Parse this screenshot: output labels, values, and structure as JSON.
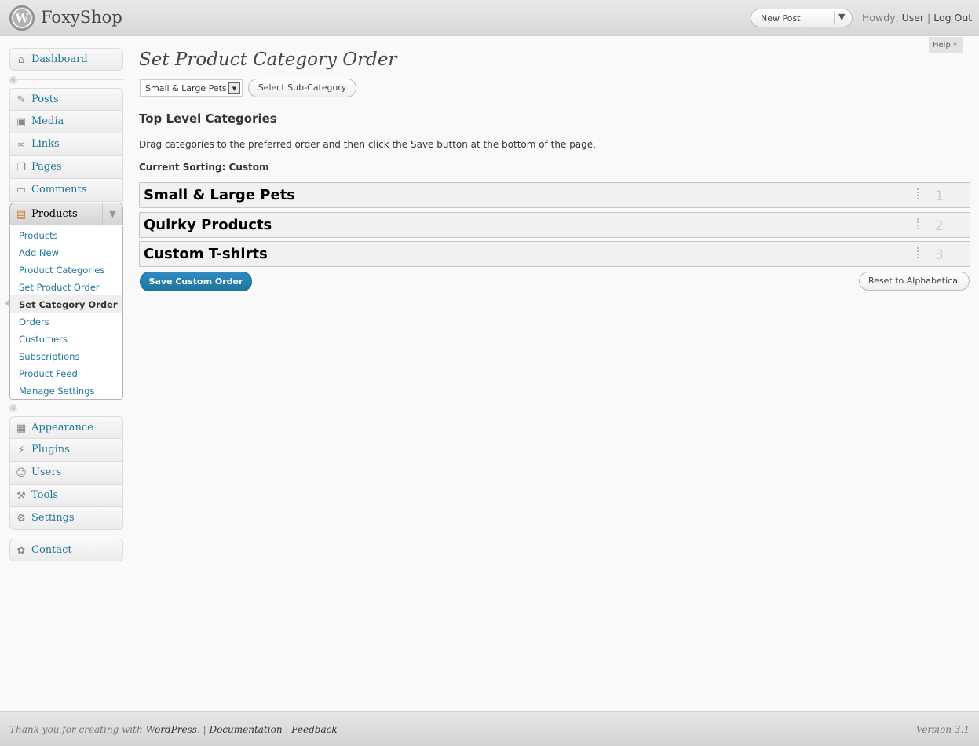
{
  "header": {
    "site_title": "FoxyShop",
    "new_post_label": "New Post",
    "greeting": "Howdy,",
    "user": "User",
    "separator": "|",
    "logout": "Log Out"
  },
  "help_tab": "Help",
  "sidebar": {
    "dashboard": "Dashboard",
    "group1": [
      {
        "label": "Posts",
        "icon": "pin-icon"
      },
      {
        "label": "Media",
        "icon": "media-icon"
      },
      {
        "label": "Links",
        "icon": "link-icon"
      },
      {
        "label": "Pages",
        "icon": "pages-icon"
      },
      {
        "label": "Comments",
        "icon": "comments-icon"
      },
      {
        "label": "Products",
        "icon": "products-icon"
      }
    ],
    "products_submenu": [
      "Products",
      "Add New",
      "Product Categories",
      "Set Product Order",
      "Set Category Order",
      "Orders",
      "Customers",
      "Subscriptions",
      "Product Feed",
      "Manage Settings"
    ],
    "current_submenu_item": "Set Category Order",
    "group2": [
      {
        "label": "Appearance",
        "icon": "appearance-icon"
      },
      {
        "label": "Plugins",
        "icon": "plugins-icon"
      },
      {
        "label": "Users",
        "icon": "users-icon"
      },
      {
        "label": "Tools",
        "icon": "tools-icon"
      },
      {
        "label": "Settings",
        "icon": "settings-icon"
      }
    ],
    "contact": "Contact"
  },
  "main": {
    "title": "Set Product Category Order",
    "category_select_value": "Small & Large Pets",
    "select_subcategory_label": "Select Sub-Category",
    "section_title": "Top Level Categories",
    "instructions": "Drag categories to the preferred order and then click the Save button at the bottom of the page.",
    "current_sorting": "Current Sorting: Custom",
    "categories": [
      {
        "name": "Small & Large Pets",
        "order": "1"
      },
      {
        "name": "Quirky Products",
        "order": "2"
      },
      {
        "name": "Custom T-shirts",
        "order": "3"
      }
    ],
    "save_label": "Save Custom Order",
    "reset_label": "Reset to Alphabetical"
  },
  "footer": {
    "thanks_prefix": "Thank you for creating with",
    "wordpress_link": "WordPress",
    "documentation": "Documentation",
    "feedback": "Feedback",
    "version": "Version 3.1"
  },
  "colors": {
    "link": "#21759b",
    "primary_button": "#21759b",
    "background": "#f9f9f9"
  }
}
